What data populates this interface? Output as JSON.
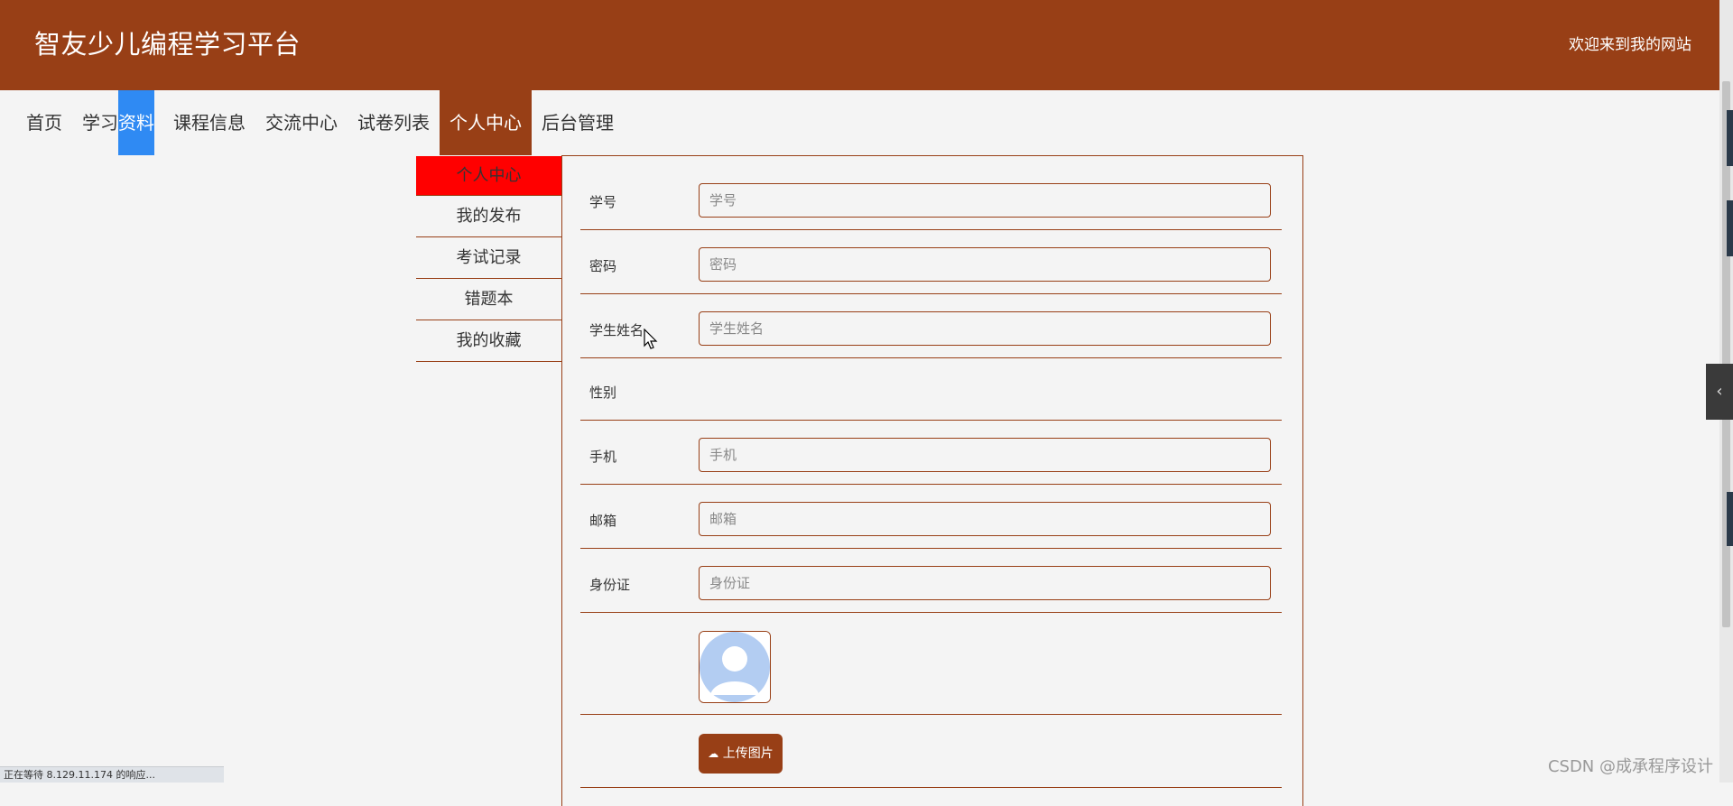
{
  "header": {
    "site_title": "智友少儿编程学习平台",
    "welcome": "欢迎来到我的网站"
  },
  "nav": {
    "items": [
      {
        "label": "首页"
      },
      {
        "label": "学习资料"
      },
      {
        "label": "课程信息"
      },
      {
        "label": "交流中心"
      },
      {
        "label": "试卷列表"
      },
      {
        "label": "个人中心",
        "active": true
      },
      {
        "label": "后台管理"
      }
    ],
    "highlight_item_prefix": "学习",
    "highlight_item_suffix": "资料"
  },
  "side_menu": {
    "items": [
      {
        "label": "个人中心",
        "active": true
      },
      {
        "label": "我的发布"
      },
      {
        "label": "考试记录"
      },
      {
        "label": "错题本"
      },
      {
        "label": "我的收藏"
      }
    ]
  },
  "form": {
    "student_id": {
      "label": "学号",
      "placeholder": "学号",
      "value": ""
    },
    "password": {
      "label": "密码",
      "placeholder": "密码",
      "value": ""
    },
    "student_name": {
      "label": "学生姓名",
      "placeholder": "学生姓名",
      "value": ""
    },
    "gender": {
      "label": "性别"
    },
    "phone": {
      "label": "手机",
      "placeholder": "手机",
      "value": ""
    },
    "email": {
      "label": "邮箱",
      "placeholder": "邮箱",
      "value": ""
    },
    "id_card": {
      "label": "身份证",
      "placeholder": "身份证",
      "value": ""
    },
    "upload_button": "上传图片"
  },
  "status_bar": {
    "text": "正在等待 8.129.11.174 的响应..."
  },
  "watermark": "CSDN @成承程序设计",
  "colors": {
    "brand": "#983f16",
    "active_side_item": "#ff0000",
    "selection_highlight": "#2f8af3",
    "background": "#f4f4f4"
  },
  "icons": {
    "upload": "cloud-upload-icon",
    "collapse_tab": "chevron-left-icon",
    "avatar": "user-avatar-placeholder"
  }
}
